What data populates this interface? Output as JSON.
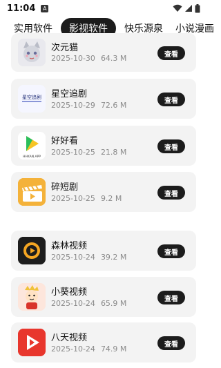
{
  "status": {
    "time": "11:04",
    "notif": "A"
  },
  "tabs": [
    {
      "label": "实用软件",
      "active": false
    },
    {
      "label": "影视软件",
      "active": true
    },
    {
      "label": "快乐源泉",
      "active": false
    },
    {
      "label": "小说漫画",
      "active": false
    }
  ],
  "apps": [
    {
      "name": "次元猫",
      "date": "2025-10-30",
      "size": "64.3 M",
      "button": "查看",
      "icon": "cat-anime-icon"
    },
    {
      "name": "星空追剧",
      "date": "2025-10-29",
      "size": "72.6 M",
      "button": "查看",
      "icon": "star-drama-icon",
      "icon_text": "星空追剧"
    },
    {
      "name": "好好看",
      "date": "2025-10-25",
      "size": "21.8 M",
      "button": "查看",
      "icon": "play-logo-icon",
      "icon_text": "HHKAN.APP"
    },
    {
      "name": "碎短剧",
      "date": "2025-10-25",
      "size": "9.2 M",
      "button": "查看",
      "icon": "clapper-icon"
    },
    {
      "name": "森林视频",
      "date": "2025-10-24",
      "size": "39.2 M",
      "button": "查看",
      "icon": "forest-play-icon"
    },
    {
      "name": "小葵视频",
      "date": "2025-10-24",
      "size": "65.9 M",
      "button": "查看",
      "icon": "cartoon-boy-icon"
    },
    {
      "name": "八天视频",
      "date": "2025-10-24",
      "size": "74.9 M",
      "button": "查看",
      "icon": "red-play-icon"
    }
  ],
  "colors": {
    "accent": "#1c1c1c",
    "card": "#f3f3f3",
    "meta": "#8a8a8a"
  }
}
